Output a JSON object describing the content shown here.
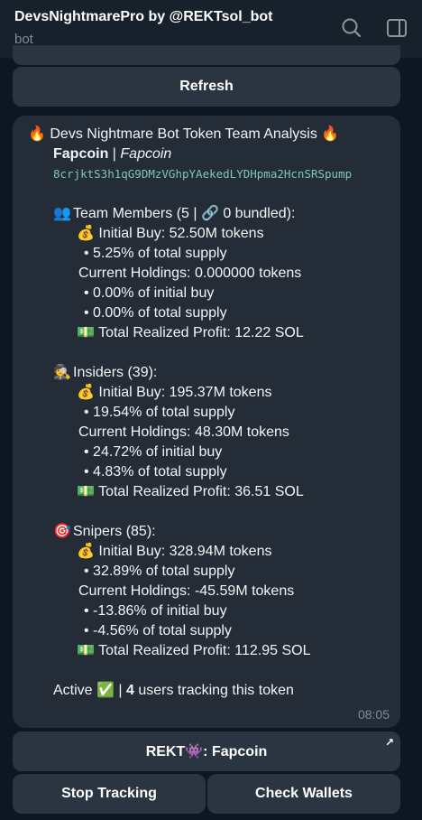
{
  "header": {
    "title": "DevsNightmarePro by @REKTsol_bot",
    "subtitle": "bot",
    "search_icon": "search-icon",
    "sidebar_icon": "sidebar-panel-icon"
  },
  "keyboard_top": {
    "refresh_label": "Refresh"
  },
  "message": {
    "title_emoji": "🔥",
    "title_text": "Devs Nightmare Bot Token Team Analysis",
    "token_name": "Fapcoin",
    "separator": "|",
    "token_name_italic": "Fapcoin",
    "contract_address": "8crjktS3h1qG9DMzVGhpYAekedLYDHpma2HcnSRSpump",
    "team": {
      "header_emoji": "👥",
      "header_text": "Team Members (5 | 🔗 0 bundled):",
      "initial_buy": "💰 Initial Buy: 52.50M tokens",
      "initial_pct": "• 5.25% of total supply",
      "current_holdings": "Current Holdings: 0.000000 tokens",
      "pct_initial": "• 0.00% of initial buy",
      "pct_supply": "• 0.00% of total supply",
      "profit": "💵 Total Realized Profit: 12.22 SOL"
    },
    "insiders": {
      "header_emoji": "🕵️",
      "header_text": "Insiders (39):",
      "initial_buy": "💰 Initial Buy: 195.37M tokens",
      "initial_pct": "• 19.54% of total supply",
      "current_holdings": "Current Holdings: 48.30M tokens",
      "pct_initial": "• 24.72% of initial buy",
      "pct_supply": "• 4.83% of total supply",
      "profit": "💵 Total Realized Profit: 36.51 SOL"
    },
    "snipers": {
      "header_emoji": "🎯",
      "header_text": "Snipers (85):",
      "initial_buy": "💰 Initial Buy: 328.94M tokens",
      "initial_pct": "• 32.89% of total supply",
      "current_holdings": "Current Holdings: -45.59M tokens",
      "pct_initial": "• -13.86% of initial buy",
      "pct_supply": "• -4.56% of total supply",
      "profit": "💵 Total Realized Profit: 112.95 SOL"
    },
    "status_prefix": "Active ✅ |",
    "users_count": "4",
    "status_suffix": "users tracking this token",
    "time": "08:05"
  },
  "keyboard": {
    "rekt_label": "REKT👾: Fapcoin",
    "rekt_icon": "external-link-arrow-icon",
    "stop_label": "Stop Tracking",
    "check_label": "Check Wallets"
  }
}
